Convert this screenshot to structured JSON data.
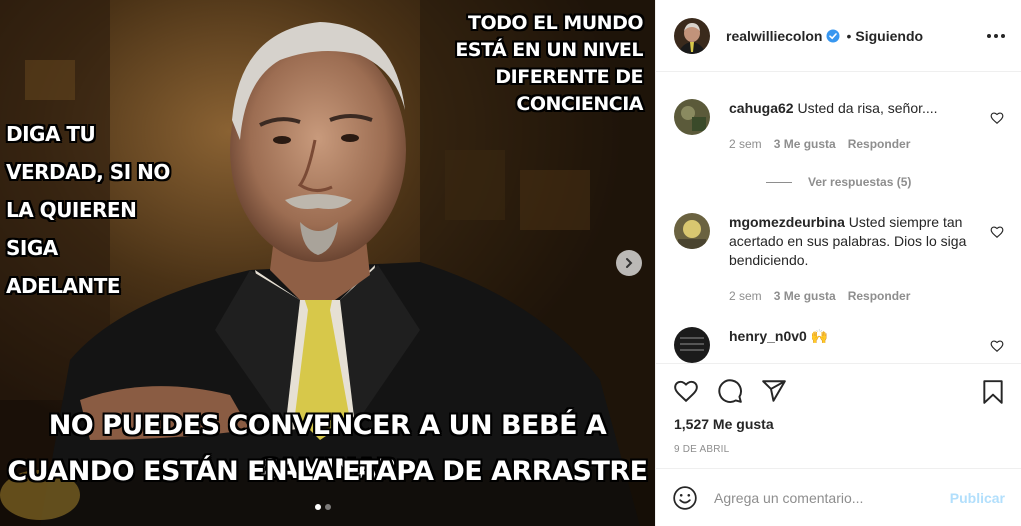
{
  "media": {
    "text_right": "TODO EL MUNDO ESTÁ EN UN NIVEL DIFERENTE DE CONCIENCIA",
    "text_left": "DIGA TU VERDAD, SI NO LA QUIEREN SIGA ADELANTE",
    "text_bottom_1": "NO PUEDES CONVENCER A UN BEBÉ A CAMINAR",
    "text_bottom_2": "CUANDO ESTÁN EN LA ETAPA DE ARRASTRE",
    "carousel_count": 2,
    "carousel_active": 1
  },
  "header": {
    "username": "realwilliecolon",
    "separator": "•",
    "follow_status": "Siguiendo",
    "verified_color": "#3897f0"
  },
  "comments": [
    {
      "username": "cahuga62",
      "text": "Usted da risa, señor....",
      "time": "2 sem",
      "likes": "3 Me gusta",
      "reply": "Responder",
      "view_replies": "Ver respuestas (5)"
    },
    {
      "username": "mgomezdeurbina",
      "text": "Usted siempre tan acertado en sus palabras. Dios lo siga bendiciendo.",
      "time": "2 sem",
      "likes": "3 Me gusta",
      "reply": "Responder"
    },
    {
      "username": "henry_n0v0",
      "text": "🙌"
    }
  ],
  "actions": {
    "like_icon": "heart-icon",
    "comment_icon": "comment-icon",
    "share_icon": "share-icon",
    "save_icon": "bookmark-icon"
  },
  "likes_text": "1,527 Me gusta",
  "date": "9 DE ABRIL",
  "add_comment": {
    "placeholder": "Agrega un comentario...",
    "publish": "Publicar",
    "publish_color": "#b2dffc"
  }
}
